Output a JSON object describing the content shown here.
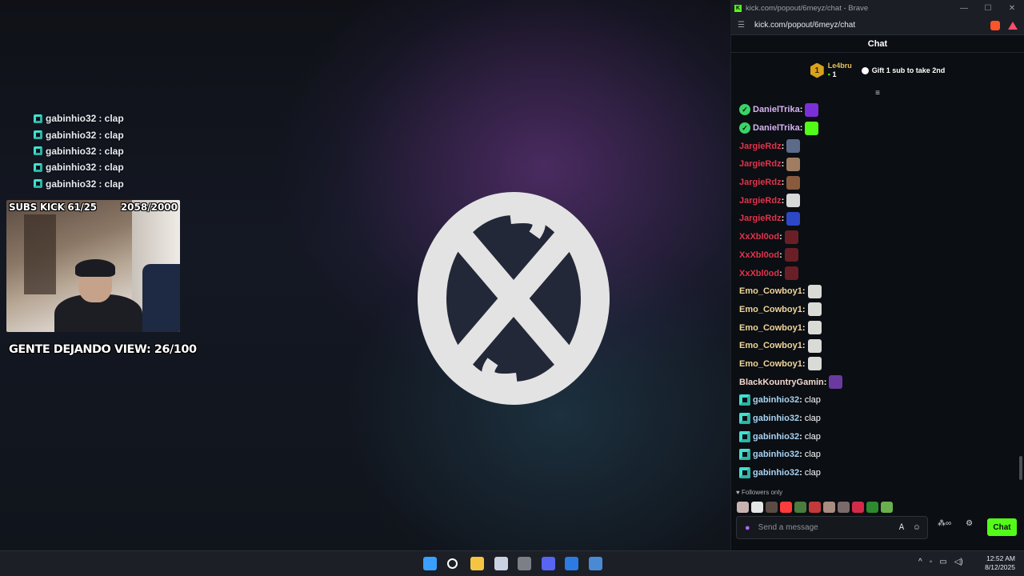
{
  "overlay_chat": [
    {
      "user": "gabinhio32",
      "text": ": clap"
    },
    {
      "user": "gabinhio32",
      "text": ": clap"
    },
    {
      "user": "gabinhio32",
      "text": ": clap"
    },
    {
      "user": "gabinhio32",
      "text": ": clap"
    },
    {
      "user": "gabinhio32",
      "text": ": clap"
    }
  ],
  "webcam": {
    "subs_goal": "SUBS KICK 61/25",
    "follower_goal": "2058/2000"
  },
  "view_goal": "GENTE DEJANDO VIEW: 26/100",
  "browser": {
    "tab_title": "kick.com/popout/6meyz/chat - Brave",
    "url": "kick.com/popout/6meyz/chat",
    "favicon_letter": "K",
    "window_controls": [
      "—",
      "☐",
      "✕"
    ]
  },
  "chat": {
    "header": "Chat",
    "leaderboard": {
      "rank": "1",
      "name": "Le4bru",
      "count": "1",
      "cta": "Gift 1 sub to take 2nd"
    },
    "messages": [
      {
        "user": "DanielTrika",
        "color": "#d7b4f3",
        "badge": "verified",
        "emote_color": "#7b2fd6"
      },
      {
        "user": "DanielTrika",
        "color": "#d7b4f3",
        "badge": "verified",
        "emote_color": "#53fc18"
      },
      {
        "user": "JargieRdz",
        "color": "#e0344c",
        "badge": "",
        "emote_color": "#5c6b8a"
      },
      {
        "user": "JargieRdz",
        "color": "#e0344c",
        "badge": "",
        "emote_color": "#a07d62"
      },
      {
        "user": "JargieRdz",
        "color": "#e0344c",
        "badge": "",
        "emote_color": "#8a5a3c"
      },
      {
        "user": "JargieRdz",
        "color": "#e0344c",
        "badge": "",
        "emote_color": "#d8d8d8"
      },
      {
        "user": "JargieRdz",
        "color": "#e0344c",
        "badge": "",
        "emote_color": "#2c48c6"
      },
      {
        "user": "XxXbl0od",
        "color": "#e0344c",
        "badge": "",
        "emote_color": "#6a1f26"
      },
      {
        "user": "XxXbl0od",
        "color": "#e0344c",
        "badge": "",
        "emote_color": "#6a1f26"
      },
      {
        "user": "XxXbl0od",
        "color": "#e0344c",
        "badge": "",
        "emote_color": "#6a1f26"
      },
      {
        "user": "Emo_Cowboy1",
        "color": "#f1d59a",
        "badge": "",
        "emote_color": "#d9dcd6"
      },
      {
        "user": "Emo_Cowboy1",
        "color": "#f1d59a",
        "badge": "",
        "emote_color": "#d9dcd6"
      },
      {
        "user": "Emo_Cowboy1",
        "color": "#f1d59a",
        "badge": "",
        "emote_color": "#d9dcd6"
      },
      {
        "user": "Emo_Cowboy1",
        "color": "#f1d59a",
        "badge": "",
        "emote_color": "#d9dcd6"
      },
      {
        "user": "Emo_Cowboy1",
        "color": "#f1d59a",
        "badge": "",
        "emote_color": "#d9dcd6"
      },
      {
        "user": "BlackKountryGamin",
        "color": "#f3d9d0",
        "badge": "",
        "emote_color": "#6b3aa0"
      },
      {
        "user": "gabinhio32",
        "color": "#a9d4f5",
        "badge": "gifter",
        "text": "clap"
      },
      {
        "user": "gabinhio32",
        "color": "#a9d4f5",
        "badge": "gifter",
        "text": "clap"
      },
      {
        "user": "gabinhio32",
        "color": "#a9d4f5",
        "badge": "gifter",
        "text": "clap"
      },
      {
        "user": "gabinhio32",
        "color": "#a9d4f5",
        "badge": "gifter",
        "text": "clap"
      },
      {
        "user": "gabinhio32",
        "color": "#a9d4f5",
        "badge": "gifter",
        "text": "clap"
      }
    ],
    "followers_only": "Followers only",
    "emote_bar_colors": [
      "#c9b3b0",
      "#e6e6e6",
      "#5a4c44",
      "#ff3b3b",
      "#4a7d3d",
      "#c43a3a",
      "#a98c80",
      "#7a6a6a",
      "#d42a4a",
      "#2d8a2d",
      "#6ab04c"
    ],
    "composer_placeholder": "Send a message",
    "send_button": "Chat",
    "accent_color": "#53fc18"
  },
  "taskbar": {
    "apps": [
      {
        "name": "windows-start",
        "color": "#3aa0ff"
      },
      {
        "name": "search",
        "color": "#ffffff"
      },
      {
        "name": "file-explorer",
        "color": "#f5c542"
      },
      {
        "name": "store",
        "color": "#c9d2e0"
      },
      {
        "name": "obs",
        "color": "#7a7f88"
      },
      {
        "name": "discord",
        "color": "#5865f2"
      },
      {
        "name": "vpn",
        "color": "#2c7be5"
      },
      {
        "name": "steam",
        "color": "#4a8ad4"
      }
    ],
    "clock_time": "12:52 AM",
    "clock_date": "8/12/2025"
  }
}
